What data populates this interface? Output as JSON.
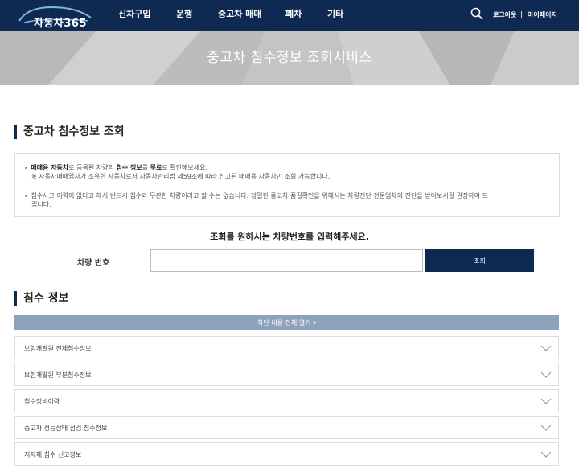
{
  "header": {
    "logo_text": "자동차365",
    "nav": [
      "신차구입",
      "운행",
      "중고차 매매",
      "폐차",
      "기타"
    ],
    "login": "로그아웃",
    "mypage": "마이페이지"
  },
  "banner": {
    "title": "중고차 침수정보 조회서비스"
  },
  "lookup_section": {
    "title": "중고차 침수정보 조회"
  },
  "notice": {
    "line1": {
      "p1": "매매용 자동차",
      "p2": "로 등록된 차량의 ",
      "p3": "침수 정보",
      "p4": "를 ",
      "p5": "무료",
      "p6": "로 확인해보세요."
    },
    "line2": "※ 자동차매매업자가 소유한 자동차로서 자동차관리법 제59조에 따라 신고된 매매용 자동차만 조회 가능합니다.",
    "line3": "침수사고 이력이 없다고 해서 반드시 침수와 무관한 차량이라고 할 수는 없습니다. 정밀한 중고차 품질확인을 위해서는 차량진단 전문업체의 진단을 받아보시길 권장하여 드",
    "line4": "립니다."
  },
  "query": {
    "title": "조회를 원하시는 차량번호를 입력해주세요.",
    "plate_label": "차량 번호",
    "plate_value": "",
    "button": "조회"
  },
  "flood_section": {
    "title": "침수 정보",
    "expand_all": "하단 내용 전체 열기 ▾",
    "items": [
      "보험개발원 전체침수정보",
      "보험개발원 부분침수정보",
      "침수정비이력",
      "중고차 성능상태 점검 침수정보",
      "지자체 침수 신고정보"
    ]
  },
  "colors": {
    "navy": "#0e2a53",
    "expand_bar": "#8fa2bb",
    "banner_gray": "#c6c6c6"
  }
}
